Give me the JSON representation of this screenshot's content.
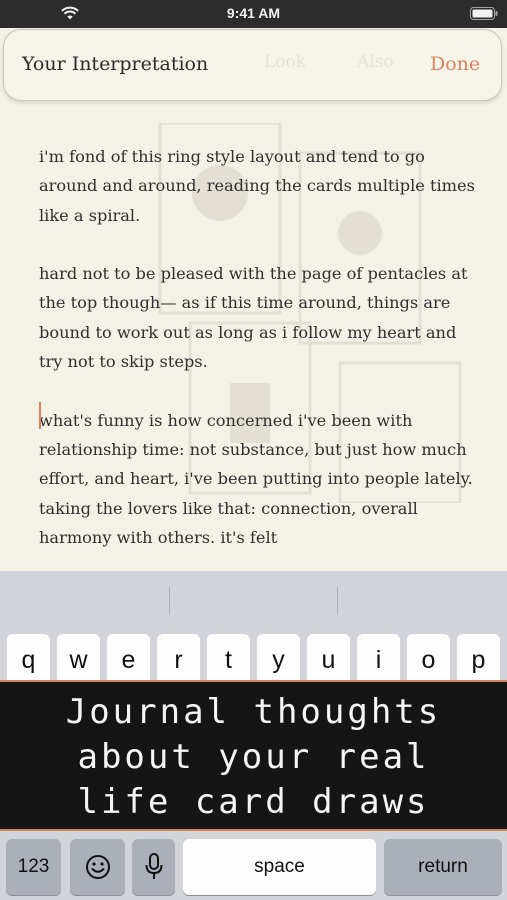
{
  "status_bar": {
    "time": "9:41 AM"
  },
  "sheet": {
    "title": "Your Interpretation",
    "done_label": "Done",
    "background_tabs": [
      "Look",
      "Also"
    ]
  },
  "journal": {
    "paragraphs": [
      "i'm fond of this ring style layout and tend to go around and around, reading the cards multiple times like a spiral.",
      "hard not to be pleased with the page of pentacles at the top though— as if this time around, things are bound to work out as long as i follow my heart and try not to skip steps.",
      "what's funny is how concerned i've been with relationship time: not substance, but just how much effort, and heart, i've been putting into people lately. taking the lovers like that: connection, overall harmony with others. it's felt"
    ]
  },
  "keyboard": {
    "top_row": [
      "q",
      "w",
      "e",
      "r",
      "t",
      "y",
      "u",
      "i",
      "o",
      "p"
    ],
    "numbers_label": "123",
    "space_label": "space",
    "return_label": "return"
  },
  "banner": {
    "line1": "Journal thoughts",
    "line2": "about your real",
    "line3": "life card draws"
  },
  "colors": {
    "accent": "#d7835f",
    "paper": "#f3f1e4",
    "banner": "#151515",
    "keyboard": "#d2d4d9"
  },
  "icons": {
    "status": [
      "wifi-icon",
      "battery-icon"
    ],
    "keyboard": [
      "emoji-icon",
      "microphone-icon"
    ]
  }
}
